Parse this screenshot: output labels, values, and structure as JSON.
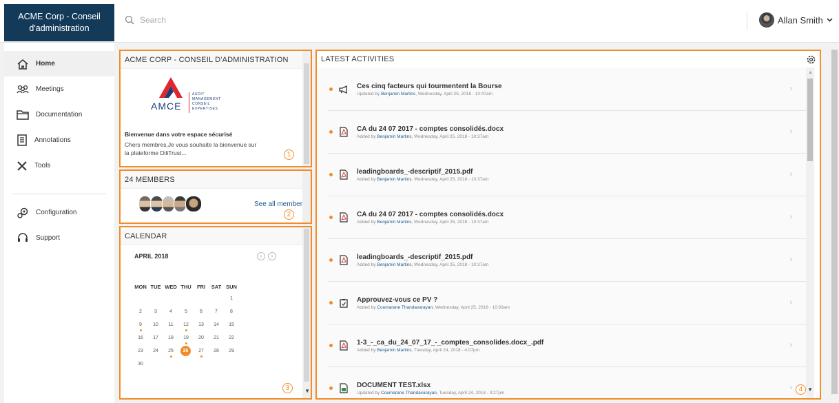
{
  "topbar": {
    "brand": "ACME Corp - Conseil d'administration",
    "search_placeholder": "Search",
    "user_name": "Allan Smith"
  },
  "sidebar": {
    "items": [
      {
        "label": "Home",
        "icon": "home-icon"
      },
      {
        "label": "Meetings",
        "icon": "people-icon"
      },
      {
        "label": "Documentation",
        "icon": "folder-icon"
      },
      {
        "label": "Annotations",
        "icon": "notes-icon"
      },
      {
        "label": "Tools",
        "icon": "tools-icon"
      }
    ],
    "bottom_items": [
      {
        "label": "Configuration",
        "icon": "gears-icon"
      },
      {
        "label": "Support",
        "icon": "headset-icon"
      }
    ]
  },
  "board_panel": {
    "title": "ACME CORP - CONSEIL D'ADMINISTRATION",
    "logo_text": "AMCE",
    "logo_tagline": [
      "AUDIT",
      "MANAGEMENT",
      "CONSEIL",
      "EXPERTISES"
    ],
    "welcome_title": "Bienvenue dans votre espace sécurisé",
    "welcome_text": "Chers membres,Je vous souhaite la bienvenue sur la plateforme DiliTrust...",
    "marker": "1"
  },
  "members_panel": {
    "title": "24 MEMBERS",
    "see_all": "See all members",
    "marker": "2"
  },
  "calendar_panel": {
    "title": "CALENDAR",
    "month": "APRIL 2018",
    "weekdays": [
      "MON",
      "TUE",
      "WED",
      "THU",
      "FRI",
      "SAT",
      "SUN"
    ],
    "weeks": [
      [
        "",
        "",
        "",
        "",
        "",
        "",
        "1"
      ],
      [
        "2",
        "3",
        "4",
        "5",
        "6",
        "7",
        "8"
      ],
      [
        "9",
        "10",
        "11",
        "12",
        "13",
        "14",
        "15"
      ],
      [
        "16",
        "17",
        "18",
        "19",
        "20",
        "21",
        "22"
      ],
      [
        "23",
        "24",
        "25",
        "26",
        "27",
        "28",
        "29"
      ],
      [
        "30",
        "",
        "",
        "",
        "",
        "",
        ""
      ]
    ],
    "today": "26",
    "event_days": [
      "9",
      "12",
      "19",
      "25",
      "27"
    ],
    "marker": "3"
  },
  "activities_panel": {
    "title": "LATEST ACTIVITIES",
    "marker": "4",
    "items": [
      {
        "icon": "megaphone-icon",
        "title": "Ces cinq facteurs qui tourmentent la Bourse",
        "action": "Updated by",
        "who": "Benjamin Martins",
        "when": ", Wednesday, April 25, 2018 - 10:47am"
      },
      {
        "icon": "pdf-icon",
        "title": "CA du 24 07 2017 - comptes consolidés.docx",
        "action": "Added by",
        "who": "Benjamin Martins",
        "when": ", Wednesday, April 25, 2018 - 10:37am"
      },
      {
        "icon": "pdf-icon",
        "title": "leadingboards_-descriptif_2015.pdf",
        "action": "Added by",
        "who": "Benjamin Martins",
        "when": ", Wednesday, April 25, 2018 - 10:37am"
      },
      {
        "icon": "pdf-icon",
        "title": "CA du 24 07 2017 - comptes consolidés.docx",
        "action": "Added by",
        "who": "Benjamin Martins",
        "when": ", Wednesday, April 25, 2018 - 10:37am"
      },
      {
        "icon": "pdf-icon",
        "title": "leadingboards_-descriptif_2015.pdf",
        "action": "Added by",
        "who": "Benjamin Martins",
        "when": ", Wednesday, April 25, 2018 - 10:37am"
      },
      {
        "icon": "clipboard-icon",
        "title": "Approuvez-vous ce PV ?",
        "action": "Added by",
        "who": "Coumarane Thandavarayan",
        "when": ", Wednesday, April 25, 2018 - 10:03am"
      },
      {
        "icon": "pdf-icon",
        "title": "1-3_-_ca_du_24_07_17_-_comptes_consolides.docx_.pdf",
        "action": "Added by",
        "who": "Benjamin Martins",
        "when": ", Tuesday, April 24, 2018 - 4:07pm"
      },
      {
        "icon": "spreadsheet-icon",
        "title": "DOCUMENT TEST.xlsx",
        "action": "Updated by",
        "who": "Coumarane Thandavarayan",
        "when": ", Tuesday, April 24, 2018 - 3:27pm"
      }
    ]
  },
  "colors": {
    "accent": "#f28c28",
    "brand": "#143a5a",
    "link": "#1e5a91"
  }
}
